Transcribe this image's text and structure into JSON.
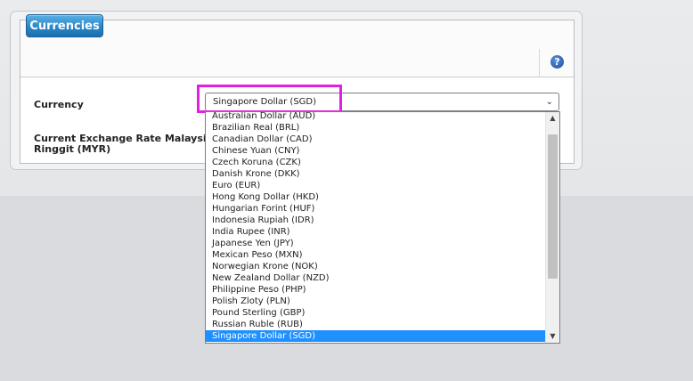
{
  "panel": {
    "title": "Currencies",
    "help_icon_glyph": "?"
  },
  "form": {
    "currency_label": "Currency",
    "rate_label_line1": "Current Exchange Rate Malaysian",
    "rate_label_line2": "Ringgit (MYR)",
    "currency_selected": "Singapore Dollar (SGD)"
  },
  "dropdown": {
    "options": [
      "Australian Dollar (AUD)",
      "Brazilian Real (BRL)",
      "Canadian Dollar (CAD)",
      "Chinese Yuan (CNY)",
      "Czech Koruna (CZK)",
      "Danish Krone (DKK)",
      "Euro (EUR)",
      "Hong Kong Dollar (HKD)",
      "Hungarian Forint (HUF)",
      "Indonesia Rupiah (IDR)",
      "India Rupee (INR)",
      "Japanese Yen (JPY)",
      "Mexican Peso (MXN)",
      "Norwegian Krone (NOK)",
      "New Zealand Dollar (NZD)",
      "Philippine Peso (PHP)",
      "Polish Zloty (PLN)",
      "Pound Sterling (GBP)",
      "Russian Ruble (RUB)",
      "Singapore Dollar (SGD)"
    ],
    "selected_index": 19
  },
  "colors": {
    "accent": "#2a87c9",
    "highlight": "#e01fe0",
    "selection": "#1e90ff"
  }
}
